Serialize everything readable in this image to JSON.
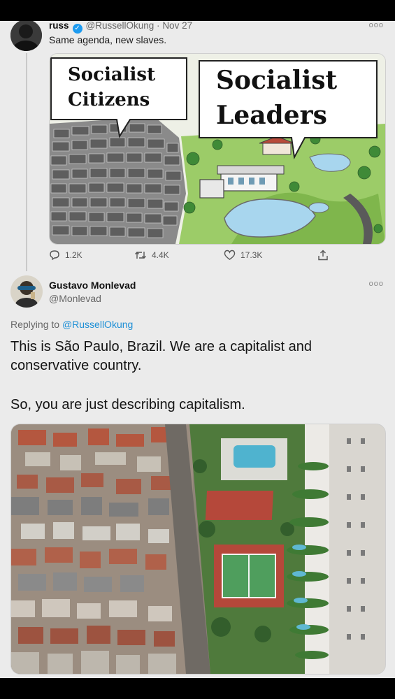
{
  "tweet1": {
    "author_name": "russ",
    "verified_icon": "verified-badge-icon",
    "handle": "@RussellOkung",
    "separator": "·",
    "date": "Nov 27",
    "more": "ooo",
    "text": "Same agenda, new slaves.",
    "meme": {
      "left_caption_line1": "Socialist",
      "left_caption_line2": "Citizens",
      "right_caption_line1": "Socialist",
      "right_caption_line2": "Leaders"
    },
    "actions": {
      "reply_count": "1.2K",
      "retweet_count": "4.4K",
      "like_count": "17.3K",
      "reply_icon": "reply-icon",
      "retweet_icon": "retweet-icon",
      "like_icon": "heart-icon",
      "share_icon": "share-icon"
    }
  },
  "tweet2": {
    "author_name": "Gustavo Monlevad",
    "handle": "@Monlevad",
    "more": "ooo",
    "replying_prefix": "Replying to",
    "replying_handle": "@RussellOkung",
    "text_line1": "This is São Paulo, Brazil. We are a capitalist and",
    "text_line2": "conservative country.",
    "text_line3": "So, you are just describing capitalism."
  },
  "colors": {
    "background": "#ebebeb",
    "link": "#1d8fd6",
    "verified": "#1d9bf0",
    "muted": "#666666"
  }
}
